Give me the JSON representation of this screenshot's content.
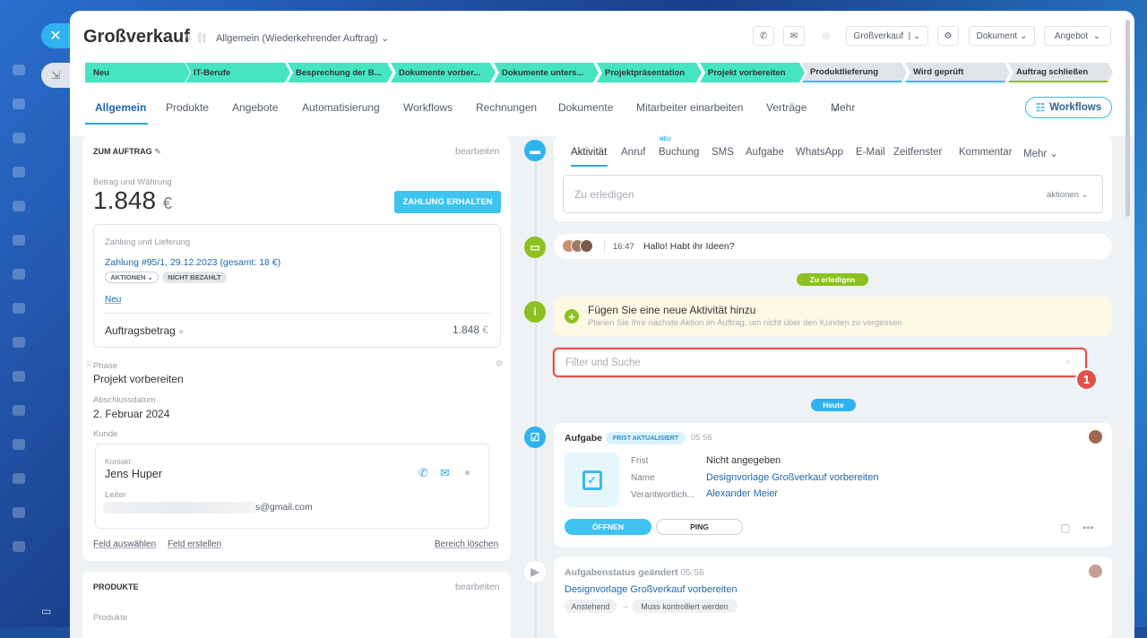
{
  "window": {
    "title": "Großverkauf",
    "subtitle": "Allgemein (Wiederkehrender Auftrag)"
  },
  "toolbar": {
    "company": "Großverkauf",
    "document": "Dokument",
    "offer": "Angebot"
  },
  "stages": [
    {
      "label": "Neu",
      "color": "#47e4c2"
    },
    {
      "label": "IT-Berufe",
      "color": "#47e4c2"
    },
    {
      "label": "Besprechung der B...",
      "color": "#47e4c2"
    },
    {
      "label": "Dokumente vorber...",
      "color": "#47e4c2"
    },
    {
      "label": "Dokumente unters...",
      "color": "#47e4c2"
    },
    {
      "label": "Projektpräsentation",
      "color": "#47e4c2"
    },
    {
      "label": "Projekt vorbereiten",
      "color": "#47e4c2"
    },
    {
      "label": "Produktlieferung",
      "color": "#e0e4e8"
    },
    {
      "label": "Wird geprüft",
      "color": "#e0e4e8"
    },
    {
      "label": "Auftrag schließen",
      "color": "#e0e4e8"
    }
  ],
  "tabs": [
    "Allgemein",
    "Produkte",
    "Angebote",
    "Automatisierung",
    "Workflows",
    "Rechnungen",
    "Dokumente",
    "Mitarbeiter einarbeiten",
    "Verträge",
    "Mehr"
  ],
  "workflows_button": "Workflows",
  "order": {
    "section_title": "ZUM AUFTRAG",
    "edit": "bearbeiten",
    "amount_label": "Betrag und Währung",
    "amount": "1.848",
    "currency": "€",
    "pay_button": "ZAHLUNG ERHALTEN",
    "payment_label": "Zahlung und Lieferung",
    "payment_link": "Zahlung #95/1, 29.12.2023 (gesamt: 18 €)",
    "actions_badge": "AKTIONEN",
    "unpaid_badge": "NICHT BEZAHLT",
    "new_link": "Neu",
    "total_label": "Auftragsbetrag",
    "total_value": "1.848",
    "total_currency": "€",
    "phase_label": "Phase",
    "phase_value": "Projekt vorbereiten",
    "close_date_label": "Abschlussdatum",
    "close_date_value": "2. Februar 2024",
    "customer_label": "Kunde",
    "contact_label": "Kontakt",
    "contact_name": "Jens Huper",
    "leader_label": "Leiter",
    "email": "s@gmail.com",
    "select_field": "Feld auswählen",
    "create_field": "Feld erstellen",
    "delete_area": "Bereich löschen"
  },
  "products": {
    "section_title": "PRODUKTE",
    "edit": "bearbeiten",
    "label": "Produkte"
  },
  "activity_tabs": [
    "Aktivität",
    "Anruf",
    "Buchung",
    "SMS",
    "Aufgabe",
    "WhatsApp",
    "E-Mail",
    "Zeitfenster",
    "Kommentar",
    "Mehr"
  ],
  "new_badge": "NEU",
  "todo": {
    "placeholder": "Zu erledigen",
    "actions": "aktionen"
  },
  "message": {
    "time": "16:47",
    "text": "Hallo! Habt ihr Ideen?"
  },
  "todo_pill": "Zu erledigen",
  "add_activity": {
    "title": "Fügen Sie eine neue Aktivität hinzu",
    "hint": "Planen Sie Ihre nächste Aktion im Auftrag, um nicht über den Kunden zu vergessen"
  },
  "filter": {
    "placeholder": "Filter und Suche",
    "marker": "1"
  },
  "today_pill": "Heute",
  "task": {
    "title": "Aufgabe",
    "badge": "FRIST AKTUALISIERT",
    "time": "05:56",
    "deadline_label": "Frist",
    "deadline_value": "Nicht angegeben",
    "name_label": "Name",
    "name_value": "Designvorlage Großverkauf vorbereiten",
    "resp_label": "Verantwortlich...",
    "resp_value": "Alexander Meier",
    "open_button": "ÖFFNEN",
    "ping_button": "PING"
  },
  "status": {
    "title": "Aufgabenstatus geändert",
    "time": "05:56",
    "link": "Designvorlage Großverkauf vorbereiten",
    "from": "Anstehend",
    "arrow": "→",
    "to": "Muss kontrolliert werden"
  },
  "colors": {
    "accent": "#2fb3f0",
    "green": "#8cc11f",
    "stage": "#47e4c2",
    "link": "#2067b0"
  }
}
